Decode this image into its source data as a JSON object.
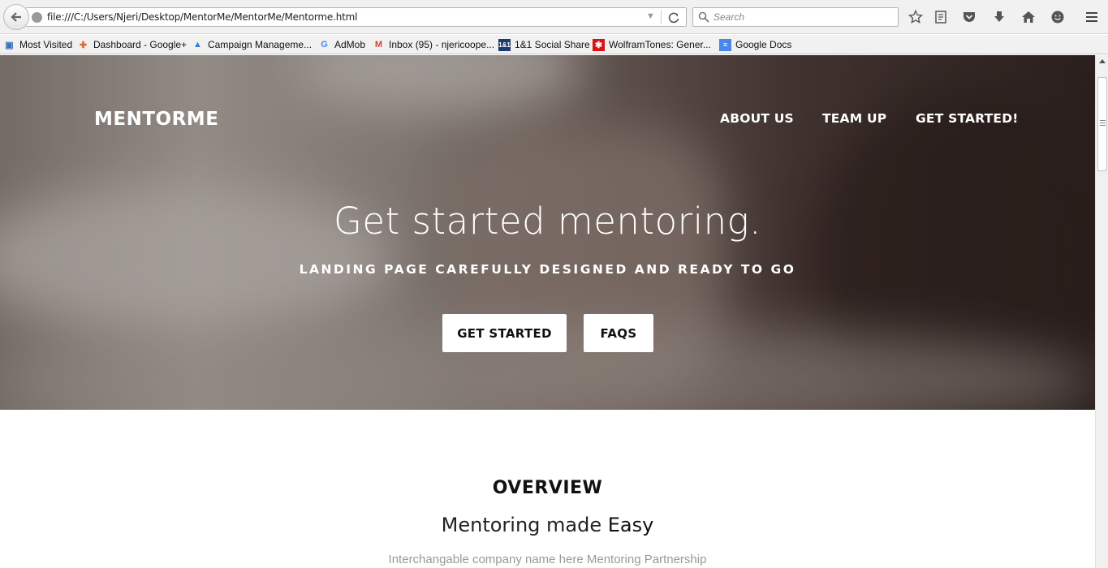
{
  "browser": {
    "url": "file:///C:/Users/Njeri/Desktop/MentorMe/MentorMe/Mentorme.html",
    "search_placeholder": "Search",
    "bookmarks": [
      {
        "label": "Most Visited",
        "icon": "bookmark-folder-icon"
      },
      {
        "label": "Dashboard - Google+",
        "icon": "google-plus-dashboard-icon"
      },
      {
        "label": "Campaign Manageme...",
        "icon": "adwords-icon"
      },
      {
        "label": "AdMob",
        "icon": "google-icon"
      },
      {
        "label": "Inbox (95) - njericoope...",
        "icon": "gmail-icon"
      },
      {
        "label": "1&1 Social Share",
        "icon": "oneandone-icon"
      },
      {
        "label": "WolframTones: Gener...",
        "icon": "wolfram-icon"
      },
      {
        "label": "Google Docs",
        "icon": "google-docs-icon"
      }
    ]
  },
  "site": {
    "brand": "MENTORME",
    "nav": [
      "ABOUT US",
      "TEAM UP",
      "GET STARTED!"
    ],
    "hero": {
      "title": "Get started mentoring.",
      "subtitle": "LANDING PAGE CAREFULLY DESIGNED AND READY TO GO",
      "buttons": [
        "GET STARTED",
        "FAQS"
      ]
    },
    "overview": {
      "heading": "OVERVIEW",
      "subheading_prefix": "Mentoring made",
      "subheading_emphasis": "Easy",
      "text": "Interchangable company name here Mentoring Partnership"
    }
  },
  "colors": {
    "hero_text": "#ffffff",
    "button_bg": "#ffffff",
    "muted_text": "#999999"
  }
}
